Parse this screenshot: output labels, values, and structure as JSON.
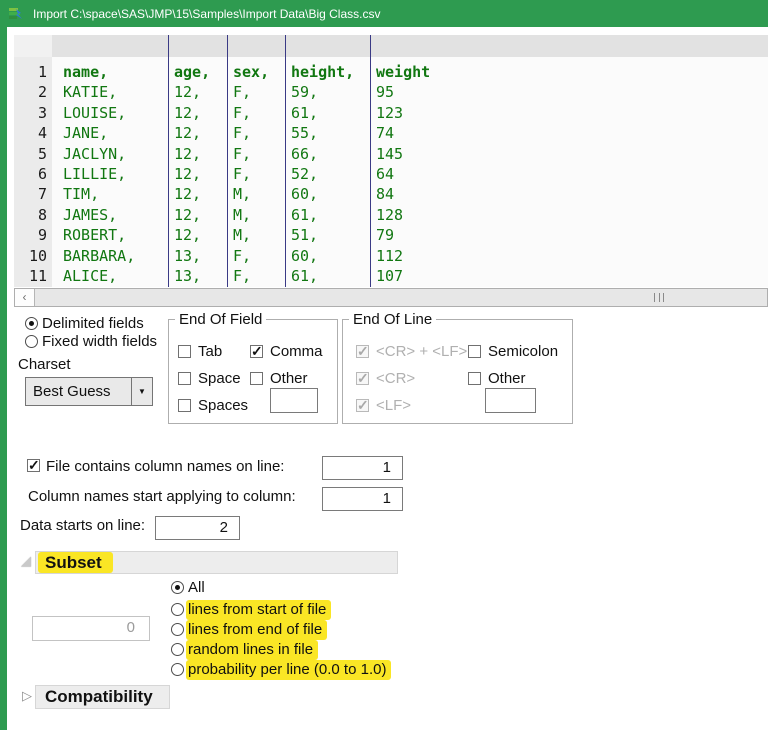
{
  "window": {
    "title": "Import C:\\space\\SAS\\JMP\\15\\Samples\\Import Data\\Big Class.csv",
    "icon": "jmp-logo-icon"
  },
  "colors": {
    "titlebar_green": "#2e9b50",
    "data_text_green": "#117711",
    "column_separator": "#3a3a85",
    "annotation_highlight": "#fae625"
  },
  "preview": {
    "line_numbers": [
      "1",
      "2",
      "3",
      "4",
      "5",
      "6",
      "7",
      "8",
      "9",
      "10",
      "11"
    ],
    "columns": [
      {
        "name": "name",
        "values": [
          "name,",
          "KATIE,",
          "LOUISE,",
          "JANE,",
          "JACLYN,",
          "LILLIE,",
          "TIM,",
          "JAMES,",
          "ROBERT,",
          "BARBARA,",
          "ALICE,"
        ]
      },
      {
        "name": "age",
        "values": [
          "age,",
          "12,",
          "12,",
          "12,",
          "12,",
          "12,",
          "12,",
          "12,",
          "12,",
          "13,",
          "13,"
        ]
      },
      {
        "name": "sex",
        "values": [
          "sex,",
          "F,",
          "F,",
          "F,",
          "F,",
          "F,",
          "M,",
          "M,",
          "M,",
          "F,",
          "F,"
        ]
      },
      {
        "name": "height",
        "values": [
          "height,",
          "59,",
          "61,",
          "55,",
          "66,",
          "52,",
          "60,",
          "61,",
          "51,",
          "60,",
          "61,"
        ]
      },
      {
        "name": "weight",
        "values": [
          "weight",
          "95",
          "123",
          "74",
          "145",
          "64",
          "84",
          "128",
          "79",
          "112",
          "107"
        ]
      }
    ],
    "scrollbar": {
      "left_arrow": "‹"
    }
  },
  "format": {
    "delimited_label": "Delimited fields",
    "fixed_label": "Fixed width fields",
    "charset_label": "Charset",
    "charset_value": "Best Guess"
  },
  "end_of_field": {
    "title": "End Of Field",
    "tab": "Tab",
    "comma": "Comma",
    "space": "Space",
    "other": "Other",
    "spaces": "Spaces",
    "other_value": ""
  },
  "end_of_line": {
    "title": "End Of Line",
    "crlf": "<CR> + <LF>",
    "cr": "<CR>",
    "lf": "<LF>",
    "semicolon": "Semicolon",
    "other": "Other",
    "other_value": ""
  },
  "lines": {
    "col_names_label": "File contains column names on line:",
    "col_names_value": "1",
    "col_start_label": "Column names start applying to column:",
    "col_start_value": "1",
    "data_start_label": "Data starts on line:",
    "data_start_value": "2"
  },
  "subset": {
    "title": "Subset",
    "count_value": "0",
    "options": [
      {
        "label": "All",
        "selected": true,
        "highlighted": false
      },
      {
        "label": "lines from start of file",
        "selected": false,
        "highlighted": true
      },
      {
        "label": "lines from end of file",
        "selected": false,
        "highlighted": true
      },
      {
        "label": "random lines in file",
        "selected": false,
        "highlighted": true
      },
      {
        "label": "probability per line (0.0 to 1.0)",
        "selected": false,
        "highlighted": true
      }
    ]
  },
  "compatibility": {
    "title": "Compatibility"
  },
  "states": {
    "delimited_selected": true,
    "fixed_selected": false,
    "eof_tab": false,
    "eof_comma": true,
    "eof_space": false,
    "eof_other": false,
    "eof_spaces": false,
    "eol_crlf": true,
    "eol_cr": true,
    "eol_lf": true,
    "eol_semicolon": false,
    "eol_other": false,
    "col_names_checked": true
  }
}
